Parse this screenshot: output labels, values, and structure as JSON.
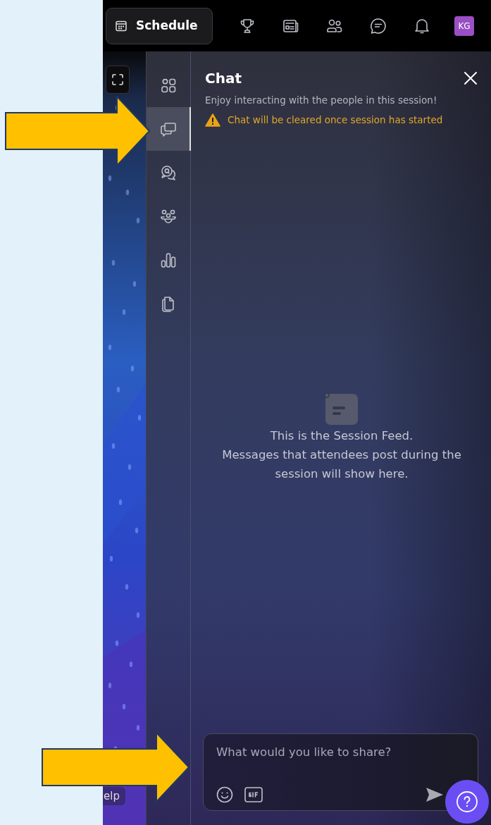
{
  "top_bar": {
    "schedule_button": "Schedule",
    "avatar": "KG"
  },
  "stage": {
    "help_button": "elp"
  },
  "rail": [
    {
      "kind": "apps",
      "selected": false
    },
    {
      "kind": "chat",
      "selected": true
    },
    {
      "kind": "qa",
      "selected": false
    },
    {
      "kind": "people",
      "selected": false
    },
    {
      "kind": "poll",
      "selected": false
    },
    {
      "kind": "files",
      "selected": false
    }
  ],
  "chat": {
    "title": "Chat",
    "subtitle": "Enjoy interacting with the people in this session!",
    "warning": "Chat will be cleared once session has started",
    "empty_state": {
      "title": "This is the Session Feed.",
      "message": "Messages that attendees post during the session will show here."
    },
    "composer": {
      "placeholder": "What would you like to share?"
    }
  }
}
